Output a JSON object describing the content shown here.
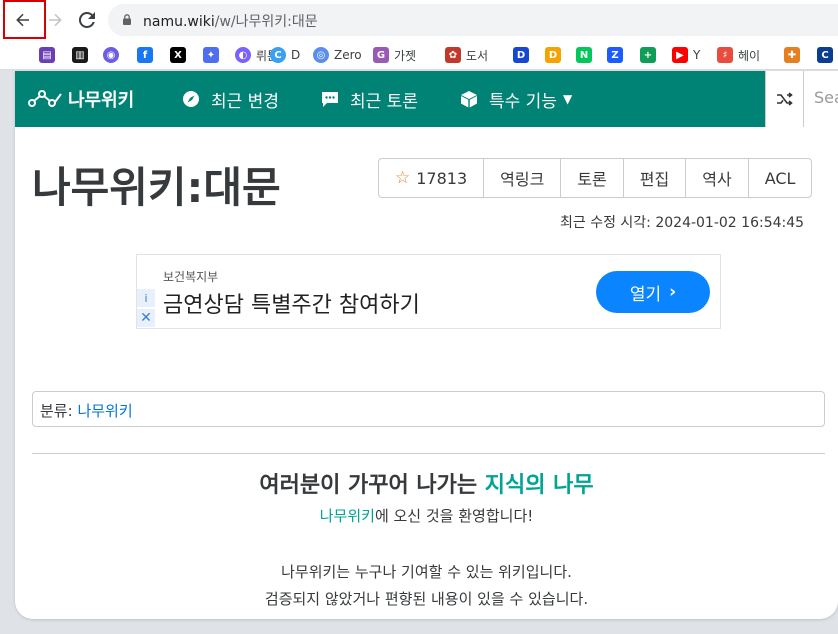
{
  "browser": {
    "url_host": "namu.wiki",
    "url_path": "/w/나무위키:대문"
  },
  "bookmarks": [
    {
      "label": "",
      "icon": "clapperboard-icon",
      "color": "#6a3fb5"
    },
    {
      "label": "",
      "icon": "chart-icon",
      "color": "#1a1a1a"
    },
    {
      "label": "",
      "icon": "purple-circle-icon",
      "color": "#6c5ce7"
    },
    {
      "label": "",
      "icon": "facebook-icon",
      "color": "#1877f2"
    },
    {
      "label": "",
      "icon": "x-icon",
      "color": "#000000"
    },
    {
      "label": "",
      "icon": "sparkle-icon",
      "color": "#4e6ef2"
    },
    {
      "label": "뤼튼",
      "icon": "wrtn-icon",
      "color": "#7b61ff"
    },
    {
      "label": "D",
      "icon": "c-icon",
      "color": "#3aa0f3"
    },
    {
      "label": "Zero",
      "icon": "zero-icon",
      "color": "#5b8def"
    },
    {
      "label": "가젯",
      "icon": "g-icon",
      "color": "#9b59b6"
    },
    {
      "label": "도서",
      "icon": "book-icon",
      "color": "#c0392b"
    },
    {
      "label": "",
      "icon": "d-blue-icon",
      "color": "#1746d1"
    },
    {
      "label": "",
      "icon": "d-color-icon",
      "color": "#f4a300"
    },
    {
      "label": "",
      "icon": "n-icon",
      "color": "#03c75a"
    },
    {
      "label": "",
      "icon": "z-icon",
      "color": "#1a5cff"
    },
    {
      "label": "",
      "icon": "plus-icon",
      "color": "#0f9d58"
    },
    {
      "label": "Y",
      "icon": "youtube-icon",
      "color": "#ff0000"
    },
    {
      "label": "헤이",
      "icon": "hey-icon",
      "color": "#e74c3c"
    },
    {
      "label": "",
      "icon": "gift-icon",
      "color": "#e67e22"
    },
    {
      "label": "",
      "icon": "c-dark-icon",
      "color": "#0b3d91"
    }
  ],
  "nav": {
    "brand": "나무위키",
    "recent_changes": "최근 변경",
    "recent_discuss": "최근 토론",
    "special": "특수 기능",
    "search_placeholder": "Sea"
  },
  "doc": {
    "title": "나무위키:대문",
    "star_count": "17813",
    "backlinks": "역링크",
    "discuss": "토론",
    "edit": "편집",
    "history": "역사",
    "acl": "ACL",
    "last_modified": "최근 수정 시각: 2024-01-02 16:54:45"
  },
  "ad": {
    "sponsor": "보건복지부",
    "headline": "금연상담 특별주간 참여하기",
    "button": "열기",
    "info": "i",
    "close": "✕"
  },
  "category": {
    "label": "분류: ",
    "link": "나무위키"
  },
  "welcome": {
    "part1": "여러분이 가꾸어 나가는 ",
    "highlight": "지식의 나무",
    "sub_link": "나무위키",
    "sub_rest": "에 오신 것을 환영합니다!",
    "line1": "나무위키는 누구나 기여할 수 있는 위키입니다.",
    "line2": "검증되지 않았거나 편향된 내용이 있을 수 있습니다."
  },
  "colors": {
    "nav_bg": "#008275",
    "accent": "#00a495",
    "link": "#0275d8",
    "ad_button": "#0b85ff"
  }
}
